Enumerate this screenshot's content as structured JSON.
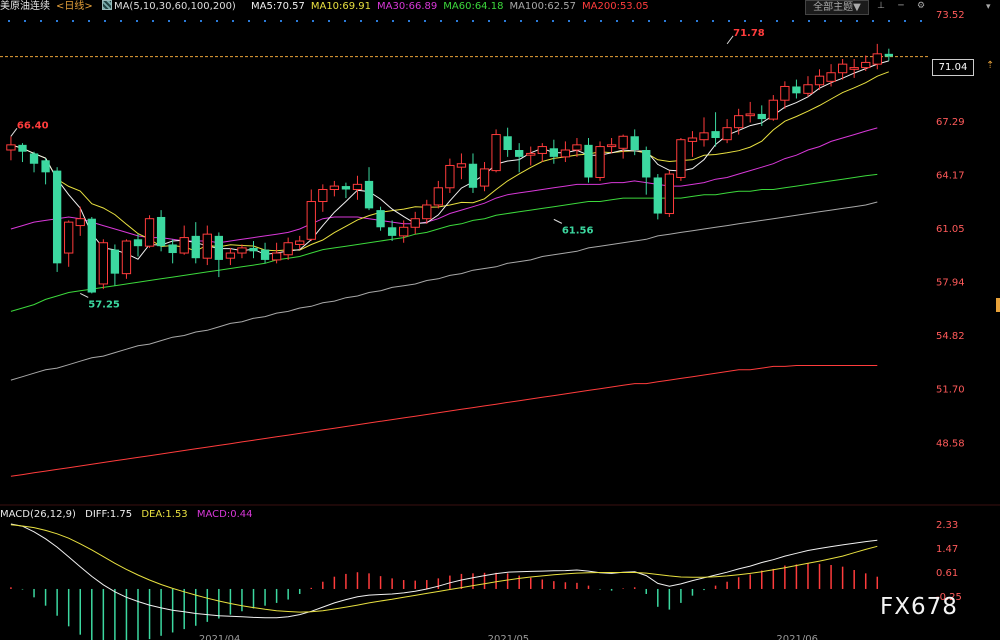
{
  "header": {
    "title": "美原油连续",
    "period": "<日线>",
    "ma_params": "MA(5,10,30,60,100,200)",
    "ma_values": [
      {
        "label": "MA5:70.57",
        "color": "#f0f0f0"
      },
      {
        "label": "MA10:69.91",
        "color": "#e8e040"
      },
      {
        "label": "MA30:66.89",
        "color": "#d838d8"
      },
      {
        "label": "MA60:64.18",
        "color": "#3cd83c"
      },
      {
        "label": "MA100:62.57",
        "color": "#a8a8a8"
      },
      {
        "label": "MA200:53.05",
        "color": "#ff3c3c"
      }
    ],
    "menu_label": "全部主题▼"
  },
  "macd_header": {
    "params": "MACD(26,12,9)",
    "diff": "DIFF:1.75",
    "dea": "DEA:1.53",
    "macd": "MACD:0.44"
  },
  "price_tag": "71.04",
  "watermark": "FX678",
  "colors": {
    "up": "#ff3c3c",
    "down": "#3cd8a0",
    "axis_text": "#ff5a5a",
    "grid_dot": "#2a7ad8",
    "dashed_line": "#e8a23a"
  },
  "chart_data": {
    "type": "candlestick",
    "main_axis": {
      "ticks": [
        73.52,
        70.41,
        67.29,
        64.17,
        61.05,
        57.94,
        54.82,
        51.7,
        48.58
      ],
      "labels": [
        "73.52",
        "",
        "67.29",
        "64.17",
        "61.05",
        "57.94",
        "54.82",
        "51.70",
        "48.58"
      ],
      "range": [
        46.5,
        73.52
      ]
    },
    "macd_axis": {
      "ticks": [
        2.33,
        1.47,
        0.61,
        -0.25
      ],
      "labels": [
        "2.33",
        "1.47",
        "0.61",
        "-0.25"
      ],
      "range": [
        -1.4,
        2.33
      ]
    },
    "x_labels": [
      "2021/04",
      "2021/05",
      "2021/06"
    ],
    "annotations": [
      {
        "text": "66.40",
        "price": 66.4,
        "index": 0,
        "color": "#ff3c3c"
      },
      {
        "text": "57.25",
        "price": 57.25,
        "index": 6,
        "color": "#3cd8a0"
      },
      {
        "text": "61.56",
        "price": 61.56,
        "index": 47,
        "color": "#3cd8a0"
      },
      {
        "text": "71.78",
        "price": 71.78,
        "index": 62,
        "color": "#ff3c3c"
      }
    ],
    "candles": [
      [
        65.6,
        65.9,
        66.4,
        65.0
      ],
      [
        65.9,
        65.5,
        66.0,
        64.9
      ],
      [
        65.4,
        64.8,
        65.5,
        64.3
      ],
      [
        65.0,
        64.3,
        65.1,
        63.6
      ],
      [
        64.4,
        59.0,
        64.6,
        58.5
      ],
      [
        59.6,
        61.4,
        61.5,
        58.8
      ],
      [
        61.2,
        61.6,
        62.3,
        60.6
      ],
      [
        61.6,
        57.3,
        61.7,
        57.25
      ],
      [
        57.8,
        60.2,
        60.4,
        57.5
      ],
      [
        59.8,
        58.4,
        60.1,
        57.7
      ],
      [
        58.4,
        60.3,
        60.4,
        58.1
      ],
      [
        60.4,
        60.0,
        60.7,
        59.4
      ],
      [
        60.0,
        61.6,
        61.8,
        59.9
      ],
      [
        61.7,
        60.0,
        62.1,
        59.7
      ],
      [
        60.1,
        59.6,
        60.4,
        59.0
      ],
      [
        59.6,
        60.5,
        61.2,
        59.5
      ],
      [
        60.6,
        59.3,
        61.4,
        59.0
      ],
      [
        59.3,
        60.7,
        61.2,
        58.9
      ],
      [
        60.6,
        59.2,
        60.8,
        58.2
      ],
      [
        59.3,
        59.6,
        59.9,
        58.9
      ],
      [
        59.6,
        59.9,
        60.1,
        59.3
      ],
      [
        59.9,
        59.7,
        60.3,
        59.3
      ],
      [
        59.8,
        59.2,
        60.2,
        59.0
      ],
      [
        59.2,
        59.6,
        60.2,
        59.0
      ],
      [
        59.5,
        60.2,
        60.5,
        59.2
      ],
      [
        60.1,
        60.3,
        60.6,
        59.8
      ],
      [
        60.4,
        62.6,
        63.3,
        60.3
      ],
      [
        62.6,
        63.3,
        63.6,
        62.0
      ],
      [
        63.3,
        63.5,
        63.8,
        62.9
      ],
      [
        63.5,
        63.3,
        63.7,
        62.8
      ],
      [
        63.3,
        63.6,
        64.1,
        62.7
      ],
      [
        63.8,
        62.2,
        64.6,
        62.1
      ],
      [
        62.1,
        61.1,
        62.3,
        60.9
      ],
      [
        61.1,
        60.6,
        61.5,
        60.3
      ],
      [
        60.6,
        61.1,
        61.5,
        60.2
      ],
      [
        61.1,
        61.6,
        62.0,
        60.7
      ],
      [
        61.6,
        62.4,
        62.7,
        61.3
      ],
      [
        62.4,
        63.4,
        63.8,
        62.2
      ],
      [
        63.4,
        64.7,
        65.1,
        63.1
      ],
      [
        64.6,
        64.8,
        65.4,
        63.9
      ],
      [
        64.8,
        63.4,
        65.4,
        63.1
      ],
      [
        63.5,
        64.5,
        64.9,
        63.2
      ],
      [
        64.4,
        66.5,
        66.8,
        64.3
      ],
      [
        66.4,
        65.6,
        66.9,
        65.2
      ],
      [
        65.6,
        65.2,
        66.0,
        64.3
      ],
      [
        65.3,
        65.4,
        65.8,
        64.7
      ],
      [
        65.4,
        65.8,
        66.0,
        64.9
      ],
      [
        65.7,
        65.2,
        66.2,
        64.8
      ],
      [
        65.2,
        65.6,
        66.1,
        64.9
      ],
      [
        65.6,
        65.9,
        66.3,
        65.2
      ],
      [
        65.9,
        64.0,
        66.3,
        63.7
      ],
      [
        64.0,
        65.8,
        66.1,
        63.8
      ],
      [
        65.8,
        65.9,
        66.3,
        65.4
      ],
      [
        65.7,
        66.4,
        66.5,
        65.1
      ],
      [
        66.4,
        65.6,
        66.8,
        65.3
      ],
      [
        65.6,
        64.0,
        65.8,
        63.0
      ],
      [
        64.0,
        61.9,
        64.2,
        61.56
      ],
      [
        61.9,
        64.2,
        64.4,
        61.7
      ],
      [
        64.0,
        66.2,
        66.3,
        63.8
      ],
      [
        66.1,
        66.3,
        66.7,
        65.2
      ],
      [
        66.2,
        66.6,
        67.5,
        65.8
      ],
      [
        66.7,
        66.3,
        67.8,
        65.8
      ],
      [
        66.2,
        66.9,
        67.4,
        66.0
      ],
      [
        66.9,
        67.6,
        68.0,
        66.5
      ],
      [
        67.6,
        67.7,
        68.4,
        67.2
      ],
      [
        67.7,
        67.4,
        68.2,
        67.0
      ],
      [
        67.4,
        68.5,
        68.8,
        67.3
      ],
      [
        68.5,
        69.3,
        69.6,
        68.0
      ],
      [
        69.3,
        68.9,
        69.7,
        68.6
      ],
      [
        68.9,
        69.4,
        69.9,
        68.7
      ],
      [
        69.4,
        69.9,
        70.3,
        69.1
      ],
      [
        69.6,
        70.1,
        70.6,
        69.3
      ],
      [
        70.1,
        70.6,
        70.9,
        69.7
      ],
      [
        70.3,
        70.4,
        70.9,
        69.8
      ],
      [
        70.4,
        70.7,
        71.1,
        70.2
      ],
      [
        70.6,
        71.2,
        71.78,
        70.3
      ],
      [
        71.2,
        71.04,
        71.5,
        70.8
      ]
    ],
    "ma_series": [
      {
        "name": "MA5",
        "color": "#f0f0f0",
        "start": 0,
        "end": 76,
        "values_start": 65.5,
        "pattern": "ma5"
      },
      {
        "name": "MA10",
        "color": "#e8e040"
      },
      {
        "name": "MA30",
        "color": "#d838d8"
      },
      {
        "name": "MA60",
        "color": "#3cd83c"
      },
      {
        "name": "MA100",
        "color": "#a8a8a8"
      },
      {
        "name": "MA200",
        "color": "#ff3c3c"
      }
    ],
    "ma_values": {
      "MA30": [
        61.0,
        61.2,
        61.4,
        61.5,
        61.6,
        61.7,
        61.6,
        61.4,
        61.2,
        61.0,
        60.8,
        60.6,
        60.5,
        60.5,
        60.4,
        60.3,
        60.3,
        60.3,
        60.2,
        60.3,
        60.4,
        60.5,
        60.6,
        60.7,
        60.8,
        61.0,
        61.3,
        61.6,
        61.7,
        61.7,
        61.7,
        61.6,
        61.5,
        61.4,
        61.3,
        61.3,
        61.4,
        61.6,
        61.9,
        62.1,
        62.3,
        62.5,
        62.8,
        63.0,
        63.1,
        63.2,
        63.3,
        63.4,
        63.5,
        63.6,
        63.6,
        63.6,
        63.7,
        63.7,
        63.8,
        63.7,
        63.6,
        63.5,
        63.5,
        63.6,
        63.7,
        63.9,
        64.0,
        64.2,
        64.4,
        64.6,
        64.8,
        65.1,
        65.3,
        65.6,
        65.8,
        66.1,
        66.3,
        66.5,
        66.7,
        66.89
      ],
      "MA60": [
        56.2,
        56.4,
        56.6,
        56.9,
        57.1,
        57.3,
        57.4,
        57.5,
        57.6,
        57.7,
        57.8,
        57.9,
        58.0,
        58.1,
        58.2,
        58.3,
        58.4,
        58.5,
        58.6,
        58.7,
        58.8,
        58.9,
        59.0,
        59.2,
        59.3,
        59.4,
        59.6,
        59.8,
        59.9,
        60.0,
        60.1,
        60.2,
        60.3,
        60.4,
        60.5,
        60.7,
        60.8,
        61.0,
        61.2,
        61.3,
        61.5,
        61.6,
        61.8,
        61.9,
        62.0,
        62.1,
        62.2,
        62.3,
        62.4,
        62.5,
        62.6,
        62.6,
        62.7,
        62.8,
        62.8,
        62.8,
        62.8,
        62.8,
        62.8,
        62.9,
        63.0,
        63.0,
        63.1,
        63.2,
        63.2,
        63.3,
        63.3,
        63.4,
        63.5,
        63.6,
        63.7,
        63.8,
        63.9,
        64.0,
        64.1,
        64.18
      ],
      "MA100": [
        52.2,
        52.4,
        52.6,
        52.8,
        52.9,
        53.1,
        53.3,
        53.5,
        53.6,
        53.8,
        54.0,
        54.2,
        54.3,
        54.5,
        54.7,
        54.8,
        55.0,
        55.1,
        55.3,
        55.5,
        55.6,
        55.8,
        55.9,
        56.1,
        56.2,
        56.4,
        56.5,
        56.7,
        56.8,
        57.0,
        57.1,
        57.3,
        57.4,
        57.6,
        57.7,
        57.8,
        58.0,
        58.1,
        58.3,
        58.4,
        58.6,
        58.7,
        58.8,
        59.0,
        59.1,
        59.2,
        59.4,
        59.5,
        59.6,
        59.7,
        59.9,
        60.0,
        60.1,
        60.2,
        60.3,
        60.4,
        60.6,
        60.7,
        60.8,
        60.9,
        61.0,
        61.1,
        61.2,
        61.3,
        61.4,
        61.5,
        61.6,
        61.7,
        61.8,
        61.9,
        62.0,
        62.1,
        62.2,
        62.3,
        62.4,
        62.57
      ],
      "MA200": [
        46.6,
        46.7,
        46.8,
        46.9,
        47.0,
        47.1,
        47.2,
        47.3,
        47.4,
        47.5,
        47.6,
        47.7,
        47.8,
        47.9,
        48.0,
        48.1,
        48.2,
        48.3,
        48.4,
        48.5,
        48.6,
        48.7,
        48.8,
        48.9,
        49.0,
        49.1,
        49.2,
        49.3,
        49.4,
        49.5,
        49.6,
        49.7,
        49.8,
        49.9,
        50.0,
        50.1,
        50.2,
        50.3,
        50.4,
        50.5,
        50.6,
        50.7,
        50.8,
        50.9,
        51.0,
        51.1,
        51.2,
        51.3,
        51.4,
        51.5,
        51.6,
        51.7,
        51.8,
        51.9,
        52.0,
        52.0,
        52.1,
        52.2,
        52.3,
        52.4,
        52.5,
        52.6,
        52.7,
        52.8,
        52.8,
        52.9,
        53.0,
        53.0,
        53.05,
        53.05,
        53.05,
        53.05,
        53.05,
        53.05,
        53.05,
        53.05
      ]
    },
    "macd": {
      "diff": [
        2.33,
        2.25,
        2.05,
        1.8,
        1.5,
        1.15,
        0.8,
        0.45,
        0.15,
        -0.1,
        -0.3,
        -0.45,
        -0.58,
        -0.68,
        -0.76,
        -0.82,
        -0.88,
        -0.92,
        -0.96,
        -0.98,
        -1.0,
        -1.02,
        -1.03,
        -1.03,
        -1.0,
        -0.92,
        -0.8,
        -0.65,
        -0.5,
        -0.38,
        -0.28,
        -0.22,
        -0.2,
        -0.18,
        -0.14,
        -0.08,
        0.0,
        0.1,
        0.22,
        0.32,
        0.4,
        0.48,
        0.55,
        0.6,
        0.62,
        0.63,
        0.64,
        0.65,
        0.66,
        0.68,
        0.64,
        0.58,
        0.56,
        0.6,
        0.62,
        0.48,
        0.2,
        0.1,
        0.18,
        0.3,
        0.4,
        0.5,
        0.6,
        0.72,
        0.82,
        0.95,
        1.05,
        1.18,
        1.28,
        1.38,
        1.45,
        1.52,
        1.58,
        1.64,
        1.7,
        1.75
      ],
      "dea": [
        2.3,
        2.26,
        2.2,
        2.1,
        1.98,
        1.82,
        1.62,
        1.4,
        1.16,
        0.92,
        0.7,
        0.5,
        0.32,
        0.16,
        0.02,
        -0.1,
        -0.22,
        -0.33,
        -0.43,
        -0.52,
        -0.6,
        -0.67,
        -0.73,
        -0.78,
        -0.81,
        -0.83,
        -0.82,
        -0.78,
        -0.72,
        -0.65,
        -0.58,
        -0.5,
        -0.43,
        -0.37,
        -0.3,
        -0.23,
        -0.16,
        -0.09,
        -0.02,
        0.05,
        0.12,
        0.19,
        0.26,
        0.32,
        0.38,
        0.43,
        0.47,
        0.51,
        0.54,
        0.57,
        0.58,
        0.59,
        0.59,
        0.59,
        0.59,
        0.57,
        0.52,
        0.47,
        0.43,
        0.42,
        0.42,
        0.44,
        0.47,
        0.51,
        0.56,
        0.62,
        0.69,
        0.76,
        0.84,
        0.92,
        1.0,
        1.09,
        1.18,
        1.3,
        1.42,
        1.53
      ]
    }
  }
}
